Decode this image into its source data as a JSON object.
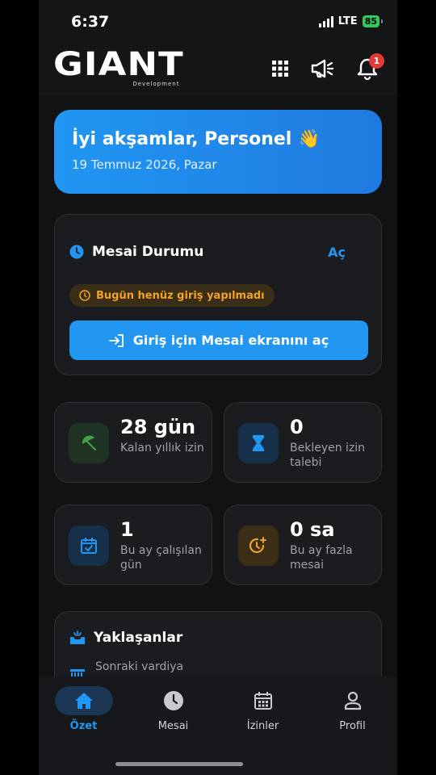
{
  "status_bar": {
    "time": "6:37",
    "network": "LTE",
    "battery": "85"
  },
  "header": {
    "logo_text": "GIANT",
    "logo_subtitle": "Development",
    "notification_count": "1"
  },
  "greeting": {
    "title": "İyi akşamlar, Personel 👋",
    "date": "19 Temmuz 2026, Pazar"
  },
  "mesai": {
    "title": "Mesai Durumu",
    "action": "Aç",
    "warning": "Bugün henüz giriş yapılmadı",
    "button": "Giriş için Mesai ekranını aç"
  },
  "stats": [
    {
      "value": "28 gün",
      "label": "Kalan yıllık izin",
      "icon": "umbrella-icon",
      "color": "#43a047"
    },
    {
      "value": "0",
      "label": "Bekleyen izin talebi",
      "icon": "hourglass-icon",
      "color": "#2196f3"
    },
    {
      "value": "1",
      "label": "Bu ay çalışılan gün",
      "icon": "calendar-check-icon",
      "color": "#2196f3"
    },
    {
      "value": "0 sa",
      "label": "Bu ay fazla mesai",
      "icon": "alarm-add-icon",
      "color": "#f0a22a"
    }
  ],
  "upcoming": {
    "title": "Yaklaşanlar",
    "next_shift_label": "Sonraki vardiya"
  },
  "tabs": [
    {
      "label": "Özet",
      "icon": "home-icon",
      "active": true
    },
    {
      "label": "Mesai",
      "icon": "clock-icon",
      "active": false
    },
    {
      "label": "İzinler",
      "icon": "calendar-icon",
      "active": false
    },
    {
      "label": "Profil",
      "icon": "person-icon",
      "active": false
    }
  ],
  "colors": {
    "accent": "#2196f3",
    "warning": "#f0a22a",
    "badge": "#e53935",
    "background": "#111214"
  }
}
